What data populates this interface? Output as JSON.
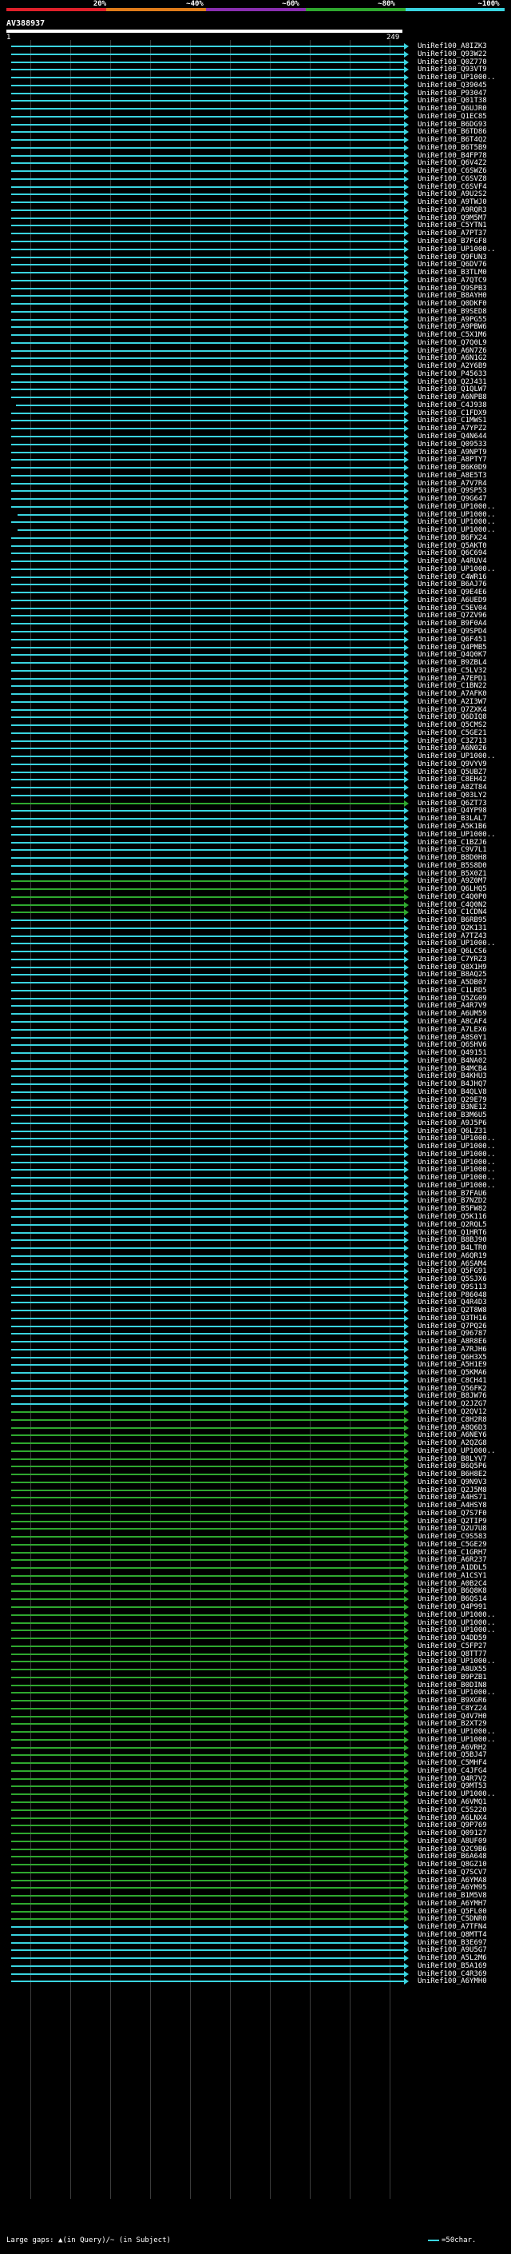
{
  "scale": {
    "labels": [
      "20%",
      "~40%",
      "~60%",
      "~80%",
      "~100%"
    ],
    "colors": [
      "#e0202a",
      "#e07c1a",
      "#8a2fb0",
      "#2fa82f",
      "#3ad4e0"
    ]
  },
  "query": {
    "name": "AV388937",
    "start": "1",
    "end": "249"
  },
  "hits": [
    "UniRef100_A8IZK3",
    "UniRef100_Q93W22",
    "UniRef100_Q0Z770",
    "UniRef100_Q93VT9",
    "UniRef100_UP1000..",
    "UniRef100_Q39045",
    "UniRef100_P93047",
    "UniRef100_Q01T38",
    "UniRef100_Q6UJR0",
    "UniRef100_Q1EC85",
    "UniRef100_B6DG93",
    "UniRef100_B6TD86",
    "UniRef100_B6T4Q2",
    "UniRef100_B6T5B9",
    "UniRef100_B4FP78",
    "UniRef100_Q6V4Z2",
    "UniRef100_C6SWZ6",
    "UniRef100_C6SVZ8",
    "UniRef100_C6SVF4",
    "UniRef100_A9U2S2",
    "UniRef100_A9TWJ0",
    "UniRef100_A9RQR3",
    "UniRef100_Q9M5M7",
    "UniRef100_C5YTN1",
    "UniRef100_A7PT37",
    "UniRef100_B7FGF8",
    "UniRef100_UP1000..",
    "UniRef100_Q9FUN3",
    "UniRef100_Q6DV76",
    "UniRef100_B3TLM0",
    "UniRef100_A7QTC9",
    "UniRef100_Q9SPB3",
    "UniRef100_B8AYH0",
    "UniRef100_Q0DKF0",
    "UniRef100_B9SED8",
    "UniRef100_A9PG55",
    "UniRef100_A9PBW6",
    "UniRef100_C5X1M6",
    "UniRef100_Q7Q0L9",
    "UniRef100_A6N7Z6",
    "UniRef100_A6N1G2",
    "UniRef100_A2Y6B9",
    "UniRef100_P45633",
    "UniRef100_Q2J431",
    "UniRef100_Q1QLW7",
    "UniRef100_A6NPB8",
    "UniRef100_C4J938",
    "UniRef100_C1FDX9",
    "UniRef100_C1MWS1",
    "UniRef100_A7YPZ2",
    "UniRef100_Q4N644",
    "UniRef100_Q09533",
    "UniRef100_A9NPT9",
    "UniRef100_A8PTY7",
    "UniRef100_B6K0D9",
    "UniRef100_A8E5T3",
    "UniRef100_A7V7R4",
    "UniRef100_Q9SP53",
    "UniRef100_Q9G647",
    "UniRef100_UP1000..",
    "UniRef100_UP1000..",
    "UniRef100_UP1000..",
    "UniRef100_UP1000..",
    "UniRef100_B6FX24",
    "UniRef100_Q5AKT0",
    "UniRef100_Q6C694",
    "UniRef100_A4RUV4",
    "UniRef100_UP1000..",
    "UniRef100_C4WR16",
    "UniRef100_B6AJ76",
    "UniRef100_Q9E4E6",
    "UniRef100_A6UED9",
    "UniRef100_C5EV04",
    "UniRef100_Q7ZV96",
    "UniRef100_B9F0A4",
    "UniRef100_Q9SPD4",
    "UniRef100_Q6F451",
    "UniRef100_Q4PMB5",
    "UniRef100_Q4Q0K7",
    "UniRef100_B9ZBL4",
    "UniRef100_C5LV32",
    "UniRef100_A7EPD1",
    "UniRef100_C1BN22",
    "UniRef100_A7AFK0",
    "UniRef100_A2I3W7",
    "UniRef100_Q7ZXK4",
    "UniRef100_Q6DIQ8",
    "UniRef100_Q5CMS2",
    "UniRef100_C5GE21",
    "UniRef100_C3Z713",
    "UniRef100_A6N026",
    "UniRef100_UP1000..",
    "UniRef100_Q9VYV9",
    "UniRef100_Q5UBZ7",
    "UniRef100_C8EH42",
    "UniRef100_A8ZT84",
    "UniRef100_Q03LY2",
    "UniRef100_Q6ZT73",
    "UniRef100_Q4YP98",
    "UniRef100_B3LAL7",
    "UniRef100_A5K1B6",
    "UniRef100_UP1000..",
    "UniRef100_C1BZJ6",
    "UniRef100_C9V7L1",
    "UniRef100_B8D0H8",
    "UniRef100_B5S8D0",
    "UniRef100_B5X0Z1",
    "UniRef100_A9Z0M7",
    "UniRef100_Q6LHQ5",
    "UniRef100_C4Q0P0",
    "UniRef100_C4Q0N2",
    "UniRef100_C1CDN4",
    "UniRef100_B6RB95",
    "UniRef100_Q2K131",
    "UniRef100_A7TZ43",
    "UniRef100_UP1000..",
    "UniRef100_Q6LCS6",
    "UniRef100_C7YRZ3",
    "UniRef100_Q8X1H9",
    "UniRef100_B8AQ25",
    "UniRef100_A5DB07",
    "UniRef100_C1LRD5",
    "UniRef100_Q5ZG09",
    "UniRef100_A4R7V9",
    "UniRef100_A6UM59",
    "UniRef100_A8CAF4",
    "UniRef100_A7LEX6",
    "UniRef100_A8S0Y1",
    "UniRef100_Q6SHV6",
    "UniRef100_Q49151",
    "UniRef100_B4NA02",
    "UniRef100_B4MCB4",
    "UniRef100_B4KHU3",
    "UniRef100_B4JHQ7",
    "UniRef100_B4QLV8",
    "UniRef100_Q29E79",
    "UniRef100_B3NE12",
    "UniRef100_B3M6U5",
    "UniRef100_A9J5P6",
    "UniRef100_Q6LZ31",
    "UniRef100_UP1000..",
    "UniRef100_UP1000..",
    "UniRef100_UP1000..",
    "UniRef100_UP1000..",
    "UniRef100_UP1000..",
    "UniRef100_UP1000..",
    "UniRef100_UP1000..",
    "UniRef100_B7FAU6",
    "UniRef100_B7NZD2",
    "UniRef100_B5FW82",
    "UniRef100_Q5K116",
    "UniRef100_Q2RQL5",
    "UniRef100_Q1HRT6",
    "UniRef100_B8BJ90",
    "UniRef100_B4LTR0",
    "UniRef100_A6QR19",
    "UniRef100_A6SAM4",
    "UniRef100_Q5FG91",
    "UniRef100_Q5SJX6",
    "UniRef100_Q9S113",
    "UniRef100_P86048",
    "UniRef100_Q4R4D3",
    "UniRef100_Q2T8W8",
    "UniRef100_Q3TH16",
    "UniRef100_Q7PQ26",
    "UniRef100_Q96787",
    "UniRef100_A8R8E6",
    "UniRef100_A7RJH6",
    "UniRef100_Q6H3X5",
    "UniRef100_A5H1E9",
    "UniRef100_Q5KMA6",
    "UniRef100_C8CH41",
    "UniRef100_Q56FK2",
    "UniRef100_B8JW76",
    "UniRef100_Q2JZG7",
    "UniRef100_Q2QV12",
    "UniRef100_C8H2R8",
    "UniRef100_A8Q6D3",
    "UniRef100_A6NEY6",
    "UniRef100_A2QZG8",
    "UniRef100_UP1000..",
    "UniRef100_B8LYV7",
    "UniRef100_B6Q5P6",
    "UniRef100_B6H8E2",
    "UniRef100_Q9N9V3",
    "UniRef100_Q2J5M8",
    "UniRef100_A4HS71",
    "UniRef100_A4HSY8",
    "UniRef100_Q7S7F0",
    "UniRef100_Q2TIP9",
    "UniRef100_Q2U7U8",
    "UniRef100_C9S583",
    "UniRef100_C5GE29",
    "UniRef100_C1GRH7",
    "UniRef100_A6R237",
    "UniRef100_A1DDL5",
    "UniRef100_A1CSY1",
    "UniRef100_A0B2C4",
    "UniRef100_B6Q8K8",
    "UniRef100_B6QS14",
    "UniRef100_Q4P991",
    "UniRef100_UP1000..",
    "UniRef100_UP1000..",
    "UniRef100_UP1000..",
    "UniRef100_Q4DD59",
    "UniRef100_C5FP27",
    "UniRef100_Q8TT77",
    "UniRef100_UP1000..",
    "UniRef100_A8UX55",
    "UniRef100_B9PZB1",
    "UniRef100_B0DIN8",
    "UniRef100_UP1000..",
    "UniRef100_B9XGR6",
    "UniRef100_C8YZ24",
    "UniRef100_Q4V7H0",
    "UniRef100_B2XT29",
    "UniRef100_UP1000..",
    "UniRef100_UP1000..",
    "UniRef100_A6VRH2",
    "UniRef100_Q5BJ47",
    "UniRef100_C5MHF4",
    "UniRef100_C4JFG4",
    "UniRef100_Q4R7V2",
    "UniRef100_Q9MT53",
    "UniRef100_UP1000..",
    "UniRef100_A6VMQ1",
    "UniRef100_C5S220",
    "UniRef100_A6LNX4",
    "UniRef100_Q9P769",
    "UniRef100_Q09127",
    "UniRef100_A8UF09",
    "UniRef100_Q2C9B6",
    "UniRef100_B6A648",
    "UniRef100_Q8GZ10",
    "UniRef100_Q7SCV7",
    "UniRef100_A6YMA8",
    "UniRef100_A6YM95",
    "UniRef100_B1M5V8",
    "UniRef100_A6YMH7",
    "UniRef100_Q5FL00",
    "UniRef100_C5DNR0",
    "UniRef100_A7TFN4",
    "UniRef100_Q8MTT4",
    "UniRef100_B3E697",
    "UniRef100_A9U5G7",
    "UniRef100_A5L2M6",
    "UniRef100_B5A169",
    "UniRef100_C4R369",
    "UniRef100_A6YMH0"
  ],
  "legend": {
    "left": "Large gaps: ▲(in Query)/~ (in Subject)",
    "right": "=50char."
  }
}
